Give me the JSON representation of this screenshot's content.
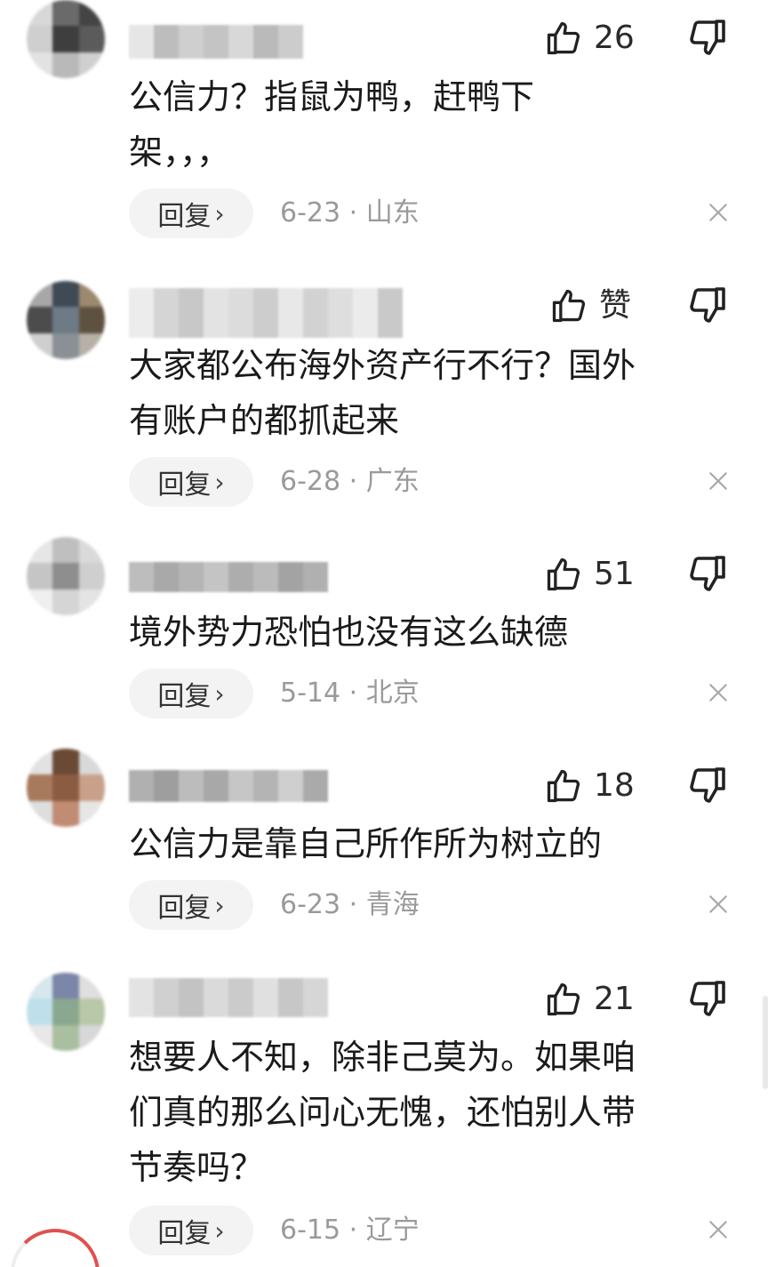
{
  "comments": [
    {
      "likes": "26",
      "text": "公信力？指鼠为鸭，赶鸭下\n架，，，",
      "reply": "回复",
      "date": "6-23",
      "location": "山东"
    },
    {
      "likes": "赞",
      "text": "大家都公布海外资产行不行？国外\n有账户的都抓起来",
      "reply": "回复",
      "date": "6-28",
      "location": "广东"
    },
    {
      "likes": "51",
      "text": "境外势力恐怕也没有这么缺德",
      "reply": "回复",
      "date": "5-14",
      "location": "北京"
    },
    {
      "likes": "18",
      "text": "公信力是靠自己所作所为树立的",
      "reply": "回复",
      "date": "6-23",
      "location": "青海"
    },
    {
      "likes": "21",
      "text": "想要人不知，除非己莫为。如果咱\n们真的那么问心无愧，还怕别人带\n节奏吗？",
      "reply": "回复",
      "date": "6-15",
      "location": "辽宁"
    }
  ],
  "separator": " · ",
  "colors": {
    "text": "#1a1a1a",
    "meta": "#9a9a9a",
    "button_bg": "#f3f3f3",
    "accent_red": "#e05050"
  },
  "icons": {
    "like": "thumbs-up-icon",
    "dislike": "thumbs-down-icon",
    "close": "close-icon",
    "reply_arrow": "chevron-right-icon"
  }
}
